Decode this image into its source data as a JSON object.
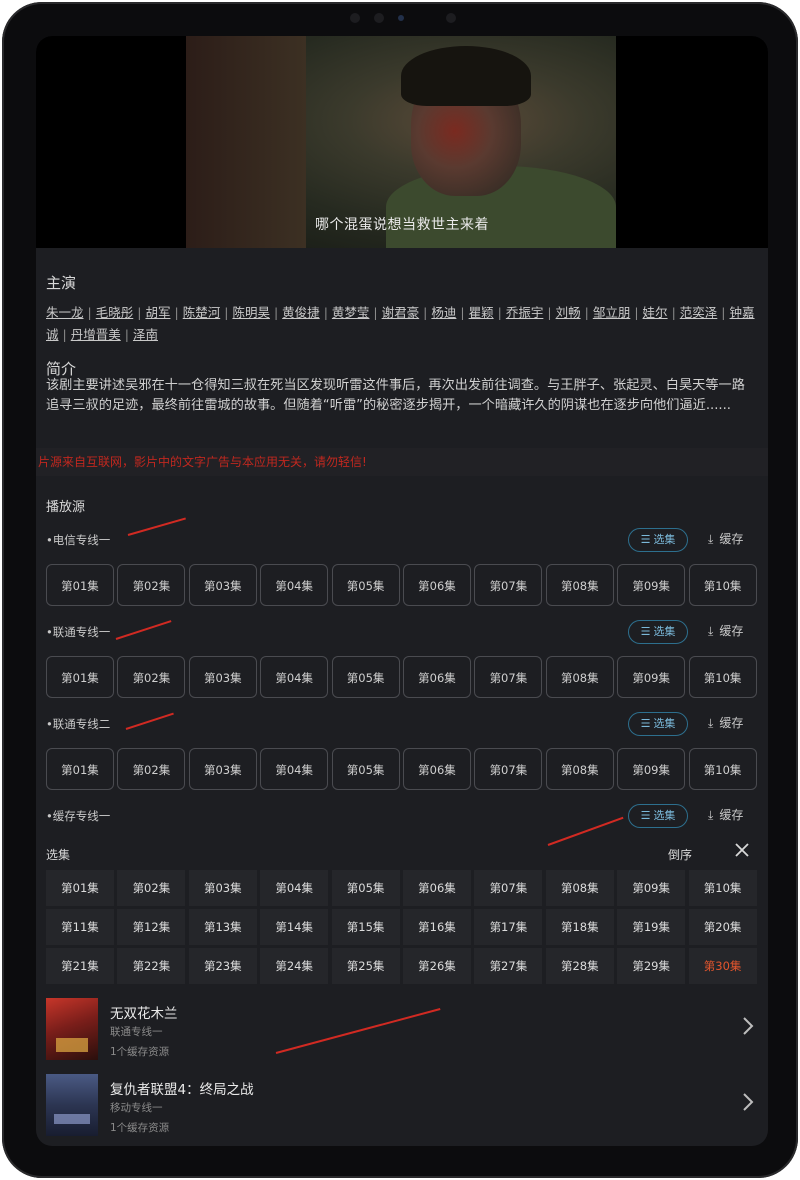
{
  "player": {
    "subtitle": "哪个混蛋说想当救世主来着"
  },
  "cast": {
    "title": "主演",
    "members": [
      "朱一龙",
      "毛晓彤",
      "胡军",
      "陈楚河",
      "陈明昊",
      "黄俊捷",
      "黄梦莹",
      "谢君豪",
      "杨迪",
      "瞿颖",
      "乔振宇",
      "刘畅",
      "邹立朋",
      "娃尔",
      "范奕泽",
      "钟嘉诚",
      "丹增晋美",
      "泽南"
    ]
  },
  "synopsis": {
    "title": "简介",
    "text": "该剧主要讲述吴邪在十一仓得知三叔在死当区发现听雷这件事后，再次出发前往调查。与王胖子、张起灵、白昊天等一路追寻三叔的足迹，最终前往雷城的故事。但随着“听雷”的秘密逐步揭开，一个暗藏许久的阴谋也在逐步向他们逼近......"
  },
  "warning": "片源来自互联网，影片中的文字广告与本应用无关，请勿轻信!",
  "sources": {
    "title": "播放源",
    "pick_label": "选集",
    "cache_label": "缓存",
    "lines": [
      {
        "name": "•电信专线一",
        "episodes": [
          "第01集",
          "第02集",
          "第03集",
          "第04集",
          "第05集",
          "第06集",
          "第07集",
          "第08集",
          "第09集",
          "第10集"
        ]
      },
      {
        "name": "•联通专线一",
        "episodes": [
          "第01集",
          "第02集",
          "第03集",
          "第04集",
          "第05集",
          "第06集",
          "第07集",
          "第08集",
          "第09集",
          "第10集"
        ]
      },
      {
        "name": "•联通专线二",
        "episodes": [
          "第01集",
          "第02集",
          "第03集",
          "第04集",
          "第05集",
          "第06集",
          "第07集",
          "第08集",
          "第09集",
          "第10集"
        ]
      },
      {
        "name": "•缓存专线一",
        "episodes": []
      }
    ]
  },
  "episode_panel": {
    "title": "选集",
    "sort_label": "倒序",
    "close_icon": "close-icon",
    "episodes": [
      "第01集",
      "第02集",
      "第03集",
      "第04集",
      "第05集",
      "第06集",
      "第07集",
      "第08集",
      "第09集",
      "第10集",
      "第11集",
      "第12集",
      "第13集",
      "第14集",
      "第15集",
      "第16集",
      "第17集",
      "第18集",
      "第19集",
      "第20集",
      "第21集",
      "第22集",
      "第23集",
      "第24集",
      "第25集",
      "第26集",
      "第27集",
      "第28集",
      "第29集",
      "第30集"
    ],
    "active": "第30集"
  },
  "cached": [
    {
      "title": "无双花木兰",
      "line": "联通专线一",
      "count": "1个缓存资源"
    },
    {
      "title": "复仇者联盟4：终局之战",
      "line": "移动专线一",
      "count": "1个缓存资源"
    }
  ],
  "colors": {
    "accent_blue": "#7bb9da",
    "active_episode": "#e2552d",
    "warning_red": "#c0281f",
    "annotation_red": "#d12a22"
  }
}
